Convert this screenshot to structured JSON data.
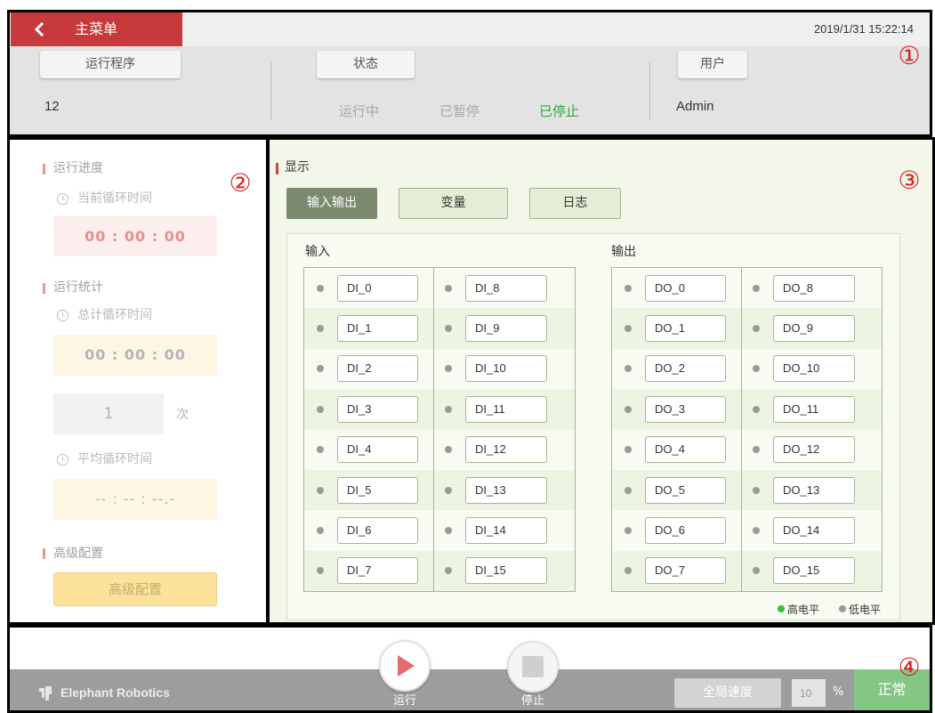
{
  "header": {
    "menu_label": "主菜单",
    "timestamp": "2019/1/31 15:22:14",
    "program": {
      "label": "运行程序",
      "value": "12"
    },
    "status": {
      "label": "状态",
      "states": [
        {
          "text": "运行中",
          "active": false
        },
        {
          "text": "已暂停",
          "active": false
        },
        {
          "text": "已停止",
          "active": true
        }
      ]
    },
    "user": {
      "label": "用户",
      "value": "Admin"
    }
  },
  "left_panel": {
    "progress": {
      "title": "运行进度",
      "current_cycle_label": "当前循环时间",
      "current_cycle_value": "00 : 00 : 00"
    },
    "statistics": {
      "title": "运行统计",
      "total_cycle_label": "总计循环时间",
      "total_cycle_value": "00 : 00 : 00",
      "cycle_count": "1",
      "cycle_count_unit": "次",
      "average_cycle_label": "平均循环时间",
      "average_cycle_value": "-- : -- : --.-"
    },
    "advanced": {
      "title": "高级配置",
      "button_label": "高级配置"
    }
  },
  "display": {
    "title": "显示",
    "tabs": [
      {
        "label": "输入输出",
        "active": true
      },
      {
        "label": "变量",
        "active": false
      },
      {
        "label": "日志",
        "active": false
      }
    ],
    "inputs": {
      "title": "输入",
      "columns": [
        [
          {
            "name": "DI_0",
            "high": false
          },
          {
            "name": "DI_1",
            "high": false
          },
          {
            "name": "DI_2",
            "high": false
          },
          {
            "name": "DI_3",
            "high": false
          },
          {
            "name": "DI_4",
            "high": false
          },
          {
            "name": "DI_5",
            "high": false
          },
          {
            "name": "DI_6",
            "high": false
          },
          {
            "name": "DI_7",
            "high": false
          }
        ],
        [
          {
            "name": "DI_8",
            "high": false
          },
          {
            "name": "DI_9",
            "high": false
          },
          {
            "name": "DI_10",
            "high": false
          },
          {
            "name": "DI_11",
            "high": false
          },
          {
            "name": "DI_12",
            "high": false
          },
          {
            "name": "DI_13",
            "high": false
          },
          {
            "name": "DI_14",
            "high": false
          },
          {
            "name": "DI_15",
            "high": false
          }
        ]
      ]
    },
    "outputs": {
      "title": "输出",
      "columns": [
        [
          {
            "name": "DO_0",
            "high": false
          },
          {
            "name": "DO_1",
            "high": false
          },
          {
            "name": "DO_2",
            "high": false
          },
          {
            "name": "DO_3",
            "high": false
          },
          {
            "name": "DO_4",
            "high": false
          },
          {
            "name": "DO_5",
            "high": false
          },
          {
            "name": "DO_6",
            "high": false
          },
          {
            "name": "DO_7",
            "high": false
          }
        ],
        [
          {
            "name": "DO_8",
            "high": false
          },
          {
            "name": "DO_9",
            "high": false
          },
          {
            "name": "DO_10",
            "high": false
          },
          {
            "name": "DO_11",
            "high": false
          },
          {
            "name": "DO_12",
            "high": false
          },
          {
            "name": "DO_13",
            "high": false
          },
          {
            "name": "DO_14",
            "high": false
          },
          {
            "name": "DO_15",
            "high": false
          }
        ]
      ]
    },
    "legend": [
      {
        "label": "高电平",
        "color": "#2fc43a"
      },
      {
        "label": "低电平",
        "color": "#9a9a9a"
      }
    ]
  },
  "footer": {
    "brand": "Elephant Robotics",
    "run_label": "运行",
    "stop_label": "停止",
    "speed_label": "全局速度",
    "speed_value": "10",
    "speed_unit": "%",
    "status": "正常"
  },
  "annotations": [
    "①",
    "②",
    "③",
    "④"
  ],
  "icons": {
    "menu_back": "chevron-left-icon",
    "cycle_time": "clock-icon",
    "run": "play-icon",
    "stop": "stop-icon",
    "brand": "elephant-logo-icon"
  },
  "colors": {
    "menu_red": "#c8393b",
    "status_active_green": "#2faa2f",
    "status_ok_green": "#84c784",
    "tab_active": "#7b8a6e",
    "section_marker_red": "#c9473f"
  }
}
